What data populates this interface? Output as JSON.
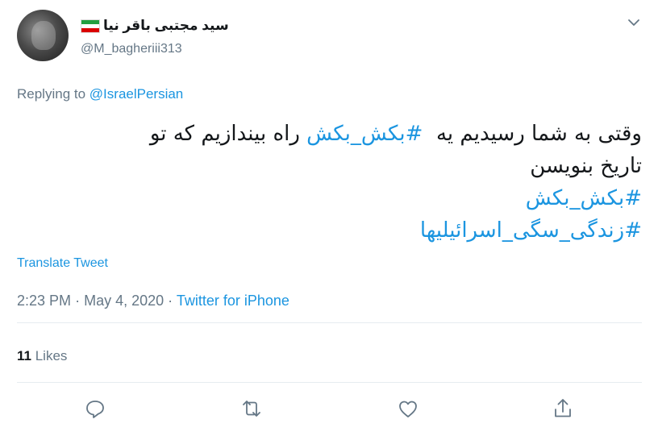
{
  "user": {
    "display_name": "سید مجتبی باقر نیا",
    "handle": "@M_bagheriii313",
    "flag_colors": [
      "#239f40",
      "#ffffff",
      "#da0000"
    ]
  },
  "reply": {
    "prefix": "Replying to",
    "mention": "@IsraelPersian"
  },
  "tweet": {
    "line1_before": "وقتی به شما رسیدیم یه",
    "line1_tag": "#بکش_بکش",
    "line1_after": "راه بیندازیم که تو",
    "line2": "تاریخ بنویسن",
    "hashtag1": "#بکش_بکش",
    "hashtag2": "#زندگی_سگی_اسرائیلیها"
  },
  "translate_label": "Translate Tweet",
  "meta": {
    "time": "2:23 PM",
    "sep1": "·",
    "date": "May 4, 2020",
    "sep2": "·",
    "source": "Twitter for iPhone"
  },
  "stats": {
    "likes_count": "11",
    "likes_label": "Likes"
  },
  "icons": [
    "reply-icon",
    "retweet-icon",
    "like-icon",
    "share-icon",
    "caret-down-icon"
  ],
  "colors": {
    "accent": "#1b95e0",
    "muted": "#657786",
    "text": "#14171a"
  }
}
